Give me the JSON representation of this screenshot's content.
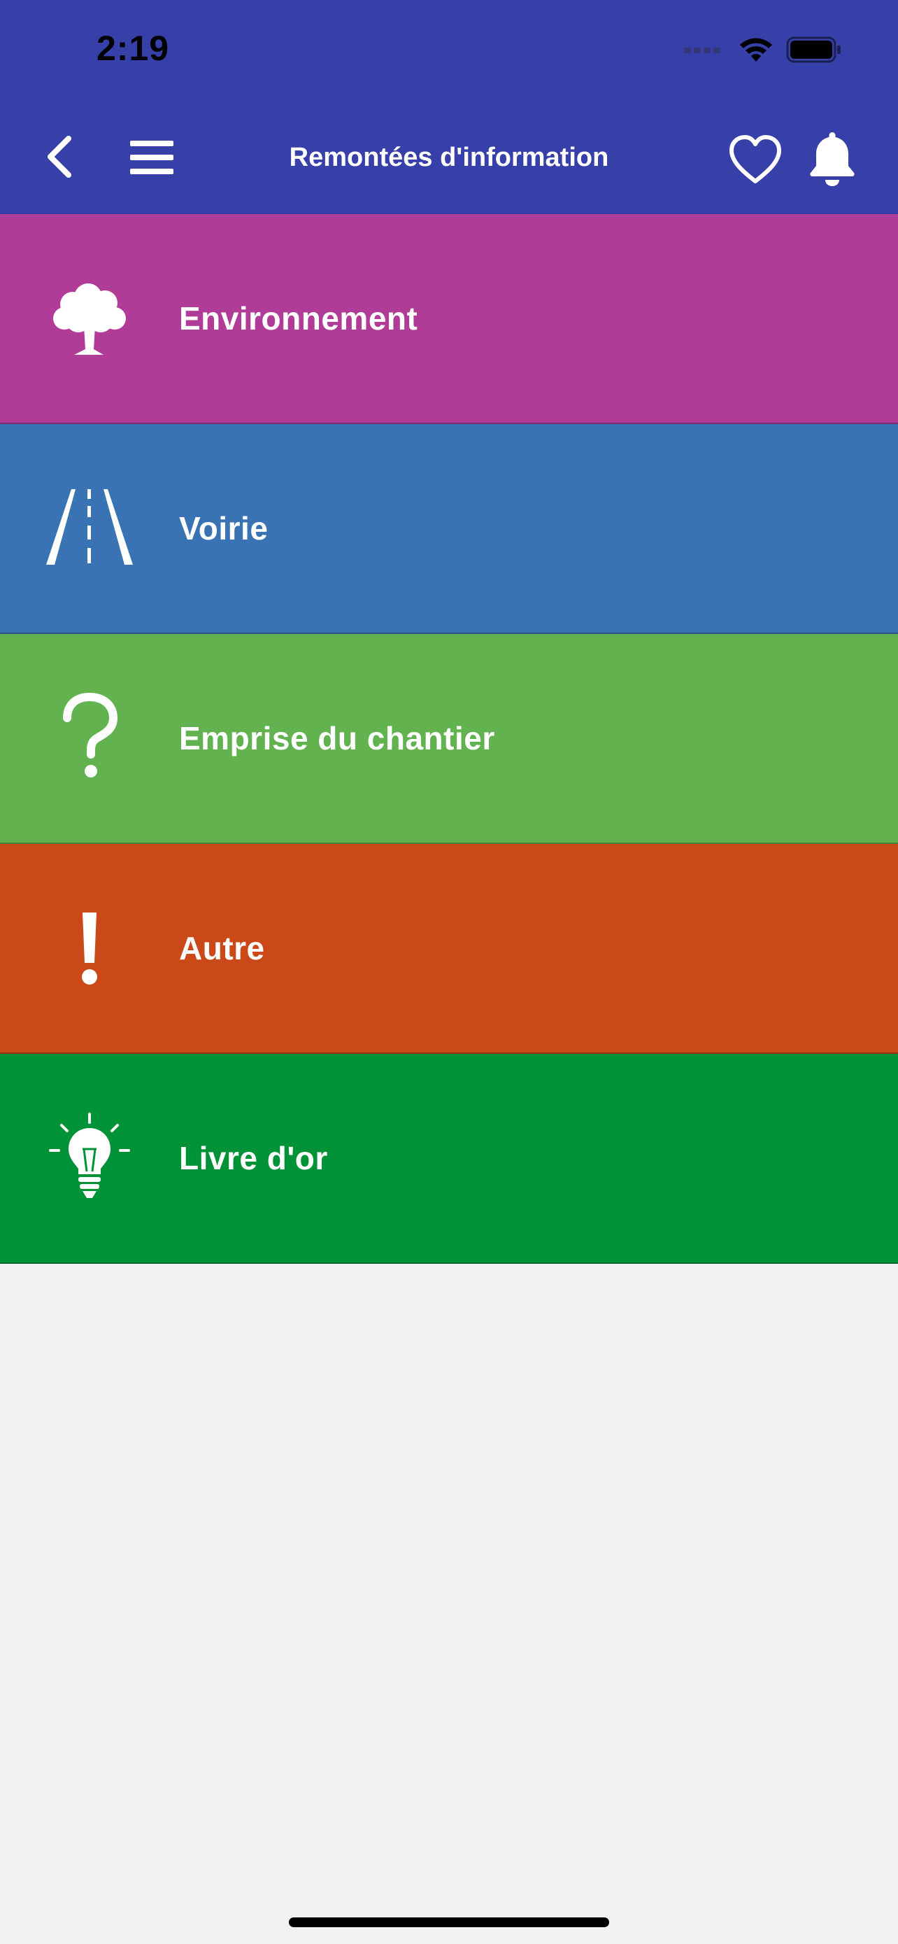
{
  "status_bar": {
    "time": "2:19"
  },
  "header": {
    "title": "Remontées d'information",
    "background_color": "#3740a8",
    "icons": {
      "back": "chevron-left-icon",
      "menu": "hamburger-menu-icon",
      "favorite": "heart-icon",
      "notifications": "bell-icon"
    }
  },
  "categories": [
    {
      "label": "Environnement",
      "icon": "tree-icon",
      "color": "#b03c97"
    },
    {
      "label": "Voirie",
      "icon": "road-icon",
      "color": "#3a73b3"
    },
    {
      "label": "Emprise du chantier",
      "icon": "question-mark-icon",
      "color": "#62b34f"
    },
    {
      "label": "Autre",
      "icon": "exclamation-icon",
      "color": "#cb4818"
    },
    {
      "label": "Livre d'or",
      "icon": "lightbulb-icon",
      "color": "#009236"
    }
  ]
}
